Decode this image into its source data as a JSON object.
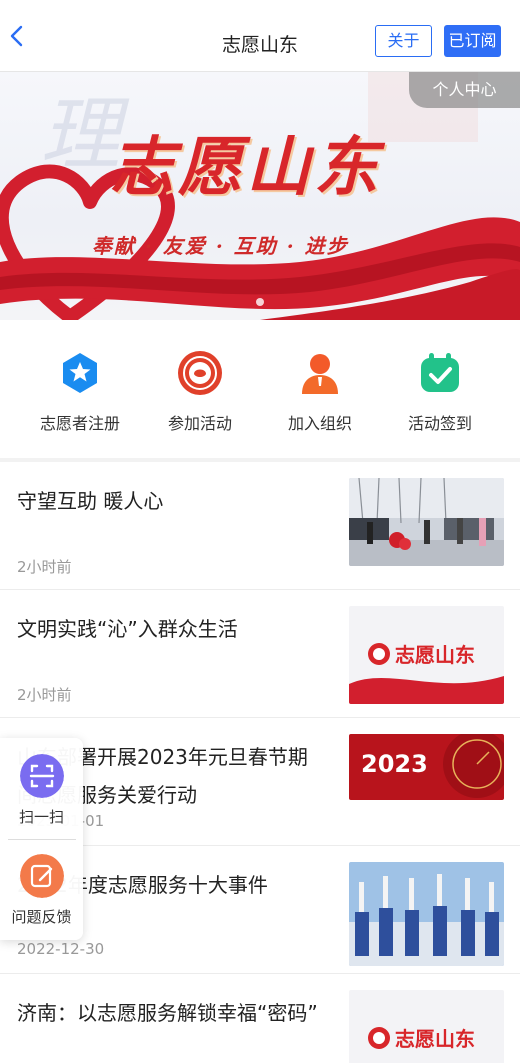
{
  "header": {
    "title": "志愿山东",
    "about_label": "关于",
    "subscribed_label": "已订阅",
    "back_icon": "chevron-left-icon"
  },
  "banner": {
    "personal_center": "个人中心",
    "title": "志愿山东",
    "slogan": "奉献 · 友爱 · 互助 · 进步"
  },
  "actions": [
    {
      "label": "志愿者注册",
      "icon": "star-badge-icon",
      "color": "#1a8cf0"
    },
    {
      "label": "参加活动",
      "icon": "volunteer-emblem-icon",
      "color": "#e0402a"
    },
    {
      "label": "加入组织",
      "icon": "person-icon",
      "color": "#f36a2a"
    },
    {
      "label": "活动签到",
      "icon": "calendar-check-icon",
      "color": "#22c28a"
    }
  ],
  "news": [
    {
      "title": "守望互助 暖人心",
      "time": "2小时前"
    },
    {
      "title": "文明实践“沁”入群众生活",
      "time": "2小时前",
      "thumb_text": "志愿山东"
    },
    {
      "title": "山东部署开展2023年元旦春节期间志愿服务关爱行动",
      "time": "2023-01-01",
      "thumb_text": "2023"
    },
    {
      "title": "2022年度志愿服务十大事件",
      "time": "2022-12-30"
    },
    {
      "title": "济南：以志愿服务解锁幸福“密码”",
      "time": "",
      "thumb_text": "志愿山东"
    }
  ],
  "floating_panel": {
    "scan_label": "扫一扫",
    "feedback_label": "问题反馈"
  },
  "colors": {
    "accent_blue": "#2f6ef6",
    "brand_red": "#d8262a",
    "scan_purple": "#7a6cf0",
    "feedback_orange": "#f37a4a"
  }
}
